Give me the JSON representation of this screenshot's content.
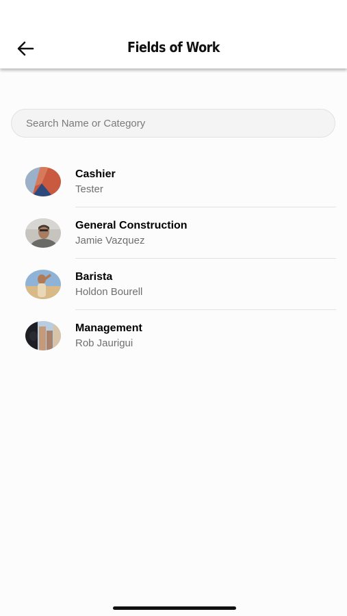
{
  "header": {
    "title": "Fields of Work",
    "back_icon": "arrow-left-icon"
  },
  "search": {
    "placeholder": "Search Name or Category",
    "value": ""
  },
  "items": [
    {
      "name": "Cashier",
      "subtitle": "Tester",
      "avatar": "abstract-graphic-avatar"
    },
    {
      "name": "General Construction",
      "subtitle": "Jamie Vazquez",
      "avatar": "person-photo-avatar"
    },
    {
      "name": "Barista",
      "subtitle": "Holdon Bourell",
      "avatar": "person-photo-avatar"
    },
    {
      "name": "Management",
      "subtitle": "Rob Jaurigui",
      "avatar": "city-photo-avatar"
    }
  ],
  "colors": {
    "text": "#000000",
    "secondary_text": "#6f6f6f",
    "divider": "#e2e2e2",
    "search_bg": "#f4f4f4"
  }
}
